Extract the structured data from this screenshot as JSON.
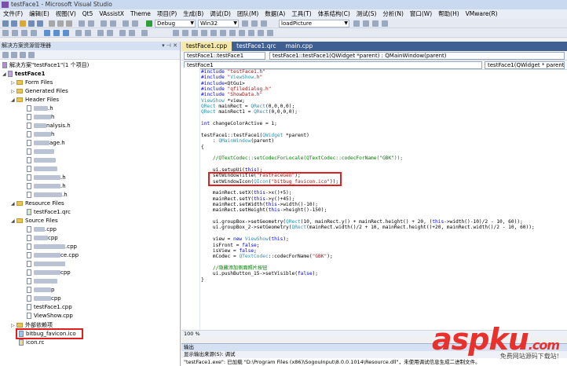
{
  "window": {
    "title": "testFace1 - Microsoft Visual Studio"
  },
  "menu": [
    "文件(F)",
    "编辑(E)",
    "视图(V)",
    "Qt5",
    "VAssistX",
    "Theme",
    "项目(P)",
    "生成(B)",
    "调试(D)",
    "团队(M)",
    "数据(A)",
    "工具(T)",
    "体系结构(C)",
    "测试(S)",
    "分析(N)",
    "窗口(W)",
    "帮助(H)",
    "VMware(R)"
  ],
  "toolbar": {
    "config": "Debug",
    "platform": "Win32",
    "find": "loadPicture"
  },
  "solution_explorer": {
    "title": "解决方案资源管理器",
    "solution": "解决方案\"testFace1\"(1 个项目)",
    "project": "testFace1",
    "folders": {
      "form": "Form Files",
      "generated": "Generated Files",
      "header": "Header Files",
      "resource": "Resource Files",
      "source": "Source Files",
      "external": "外部依赖项"
    },
    "header_files": [
      ".h",
      "h",
      "nalysis.h",
      "h",
      "age.h",
      "",
      "",
      "",
      ".h",
      ".h",
      ".h"
    ],
    "resource_files": [
      "testFace1.qrc"
    ],
    "source_files": [
      ".cpp",
      "cpp",
      ".cpp",
      "ce.cpp",
      "",
      "cpp",
      "",
      "p",
      "cpp",
      "testFace1.cpp",
      "ViewShow.cpp"
    ],
    "extra_files": [
      "bitbug_favicon.ico",
      "icon.rc"
    ]
  },
  "editor": {
    "tabs": [
      "testFace1.cpp",
      "testFace1.qrc",
      "main.cpp"
    ],
    "scope_left": "testFace1::testFace1",
    "scope_right": "testFace1::testFace1(QWidget *parent) : QMainWindow(parent)",
    "nav_left": "testFace1",
    "nav_right": "testFace1(QWidget * parent)",
    "zoom": "100 %"
  },
  "code": [
    "#include \"testFace1.h\"",
    "#include \"ViewShow.h\"",
    "#include<QtGui>",
    "#include \"qfiledialog.h\"",
    "#include \"ShowData.h\"",
    "ViewShow *view;",
    "QRect mainRect = QRect(0,0,0,0);",
    "QRect mainRect1 = QRect(0,0,0,0);",
    "",
    "int changeColorActive = 1;",
    "",
    "testFace1::testFace1(QWidget *parent)",
    "    : QMainWindow(parent)",
    "{",
    "",
    "    //QTextCodec::setCodecForLocale(QTextCodec::codecForName(\"GBK\"));",
    "",
    "    ui.setupUi(this);",
    "    setWindowTitle(\"FastFaceGen\");",
    "    setWindowIcon(QIcon(\"bitbug_favicon.ico\"));",
    "",
    "    mainRect.setX(this->x()+5);",
    "    mainRect.setY(this->y()+45);",
    "    mainRect.setWidth(this->width()-10);",
    "    mainRect.setHeight(this->height()-150);",
    "",
    "    ui.groupBox->setGeometry(QRect(10, mainRect.y() + mainRect.height() + 20, (this->width()-10)/2 - 10, 60));",
    "    ui.groupBox_2->setGeometry(QRect(mainRect.width()/2 + 10, mainRect.height()+20, mainRect.width()/2 - 10, 60));",
    "",
    "    view = new ViewShow(this);",
    "    isFront = false;",
    "    isView = false;",
    "    mCodec = QTextCodec::codecForName(\"GBK\");",
    "",
    "    //隐藏添加侧面照片按钮",
    "    ui.pushButton_15->setVisible(false);",
    "}"
  ],
  "output": {
    "title": "输出",
    "source_label": "显示输出来源(S): 调试",
    "text": "\"testFace1.exe\": 已加载 \"D:\\Program Files (x86)\\SogouInput\\8.0.0.1014\\Resource.dll\"，未使用调试信息生成二进制文件。"
  },
  "watermark": {
    "brand": "aspku",
    "suffix": ".com",
    "tagline": "免费网站源码下载站!"
  }
}
